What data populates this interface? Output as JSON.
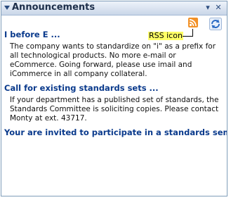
{
  "portlet": {
    "title": "Announcements"
  },
  "callout": {
    "label": "RSS icon"
  },
  "icons": {
    "rss": "rss-icon",
    "refresh": "refresh-icon",
    "menu": "chevron-down-icon",
    "close": "close-icon"
  },
  "colors": {
    "titlebar": "#c9d6e8",
    "link": "#0a3a8c",
    "callout_bg": "#ffff66",
    "rss": "#f29127"
  },
  "announcements": [
    {
      "title": "I before E ...",
      "body": "The company wants to standardize on \"i\" as a prefix for all technological products. No more e-mail or eCommerce. Going forward, please use imail and iCommerce in all company collateral."
    },
    {
      "title": "Call for existing standards sets ...",
      "body": "If your department has a published set of standards, the Standards Committee is soliciting copies. Please contact Monty at ext. 43717."
    },
    {
      "title": "Your are invited to participate in a standards seminar ...",
      "body": ""
    }
  ]
}
